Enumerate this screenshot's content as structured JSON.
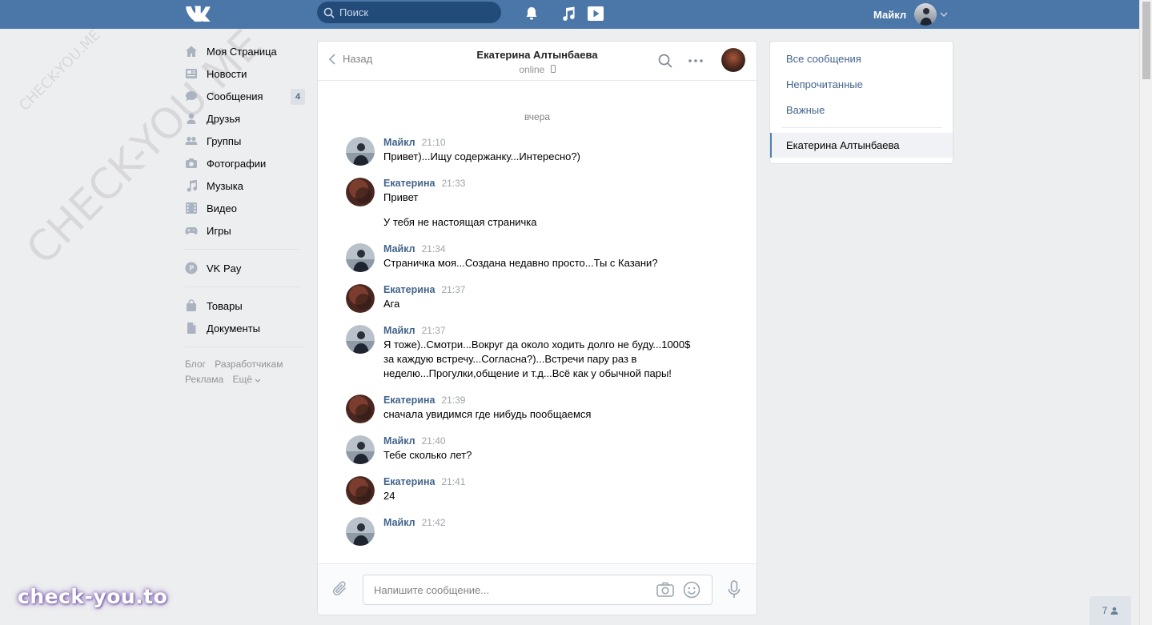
{
  "header": {
    "search_placeholder": "Поиск",
    "user_name": "Майкл"
  },
  "watermark": {
    "text_small": "CHECK-YOU.ME",
    "text_large": "CHECK-YOU.ME"
  },
  "sidebar": {
    "items": [
      {
        "label": "Моя Страница",
        "icon": "home-icon"
      },
      {
        "label": "Новости",
        "icon": "news-icon"
      },
      {
        "label": "Сообщения",
        "icon": "messages-icon",
        "badge": "4"
      },
      {
        "label": "Друзья",
        "icon": "friends-icon"
      },
      {
        "label": "Группы",
        "icon": "groups-icon"
      },
      {
        "label": "Фотографии",
        "icon": "camera-icon"
      },
      {
        "label": "Музыка",
        "icon": "music-icon"
      },
      {
        "label": "Видео",
        "icon": "video-icon"
      },
      {
        "label": "Игры",
        "icon": "games-icon"
      }
    ],
    "pay": {
      "label": "VK Pay",
      "icon": "vkpay-icon"
    },
    "extra": [
      {
        "label": "Товары",
        "icon": "bag-icon"
      },
      {
        "label": "Документы",
        "icon": "document-icon"
      }
    ],
    "footer": [
      "Блог",
      "Разработчикам",
      "Реклама",
      "Ещё"
    ]
  },
  "chat": {
    "back_label": "Назад",
    "peer_name": "Екатерина Алтынбаева",
    "peer_status": "online",
    "day_label": "вчера",
    "messages": [
      {
        "author": "Майкл",
        "time": "21:10",
        "texts": [
          "Привет)...Ищу содержанку...Интересно?)"
        ],
        "who": "me"
      },
      {
        "author": "Екатерина",
        "time": "21:33",
        "texts": [
          "Привет",
          "У тебя не настоящая страничка"
        ],
        "who": "peer"
      },
      {
        "author": "Майкл",
        "time": "21:34",
        "texts": [
          "Страничка моя...Создана недавно просто...Ты с Казани?"
        ],
        "who": "me"
      },
      {
        "author": "Екатерина",
        "time": "21:37",
        "texts": [
          "Ага"
        ],
        "who": "peer"
      },
      {
        "author": "Майкл",
        "time": "21:37",
        "texts": [
          "Я тоже)..Смотри...Вокруг да около ходить долго не буду...1000$ за каждую встречу...Согласна?)...Встречи пару раз в неделю...Прогулки,общение и т.д...Всё как у обычной пары!"
        ],
        "who": "me"
      },
      {
        "author": "Екатерина",
        "time": "21:39",
        "texts": [
          "сначала увидимся где нибудь пообщаемся"
        ],
        "who": "peer"
      },
      {
        "author": "Майкл",
        "time": "21:40",
        "texts": [
          "Тебе сколько лет?"
        ],
        "who": "me"
      },
      {
        "author": "Екатерина",
        "time": "21:41",
        "texts": [
          "24"
        ],
        "who": "peer"
      },
      {
        "author": "Майкл",
        "time": "21:42",
        "texts": [],
        "who": "me"
      }
    ],
    "input_placeholder": "Напишите сообщение..."
  },
  "right_menu": {
    "all": "Все сообщения",
    "unread": "Непрочитанные",
    "important": "Важные",
    "active": "Екатерина Алтынбаева"
  },
  "brand_watermark": "check-you.to",
  "online_count": "7",
  "colors": {
    "header": "#4a76a8",
    "link": "#42648b",
    "background": "#edeef0"
  }
}
